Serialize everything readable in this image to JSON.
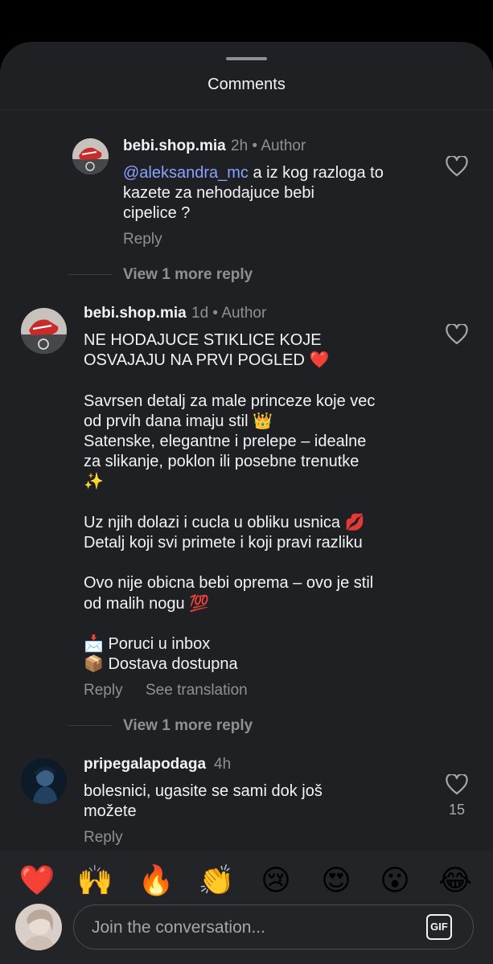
{
  "sheet": {
    "title": "Comments"
  },
  "comments": [
    {
      "username": "bebi.shop.mia",
      "time": "2h",
      "badge": "Author",
      "mention": "@aleksandra_mc",
      "text_lines": [
        "a iz kog razloga to",
        "kazete za nehodajuce bebi",
        "cipelice ?"
      ],
      "reply": "Reply",
      "view_more": "View 1 more reply"
    },
    {
      "username": "bebi.shop.mia",
      "time": "1d",
      "badge": "Author",
      "body": "NE HODAJUCE STIKLICE KOJE\nOSVAJAJU NA PRVI POGLED ❤️\n\nSavrsen detalj za male princeze koje vec\nod prvih dana imaju stil 👑\nSatenske, elegantne i prelepe – idealne\nza slikanje, poklon ili posebne trenutke\n✨\n\nUz njih dolazi i cucla u obliku usnica 💋\nDetalj koji svi primete i koji pravi razliku\n\nOvo nije obicna bebi oprema – ovo je stil\nod malih nogu 💯\n\n📩 Poruci u inbox\n📦 Dostava dostupna",
      "reply": "Reply",
      "translate": "See translation",
      "view_more": "View 1 more reply"
    },
    {
      "username": "pripegalapodaga",
      "time": "4h",
      "body": "bolesnici, ugasite se sami dok još\nmožete",
      "reply": "Reply",
      "likes": "15"
    }
  ],
  "reactions": [
    {
      "name": "heart",
      "glyph": "❤️"
    },
    {
      "name": "raising-hands",
      "glyph": "🙌"
    },
    {
      "name": "fire",
      "glyph": "🔥"
    },
    {
      "name": "clapping",
      "glyph": "👏"
    },
    {
      "name": "crying",
      "glyph": "😢"
    },
    {
      "name": "heart-eyes",
      "glyph": "😍"
    },
    {
      "name": "surprised",
      "glyph": "😮"
    },
    {
      "name": "tears-of-joy",
      "glyph": "😂"
    }
  ],
  "composer": {
    "placeholder": "Join the conversation...",
    "gif_label": "GIF"
  },
  "colors": {
    "sheet_bg": "#1f2024",
    "mention": "#8aa1ff",
    "secondary_text": "#8f9096"
  }
}
